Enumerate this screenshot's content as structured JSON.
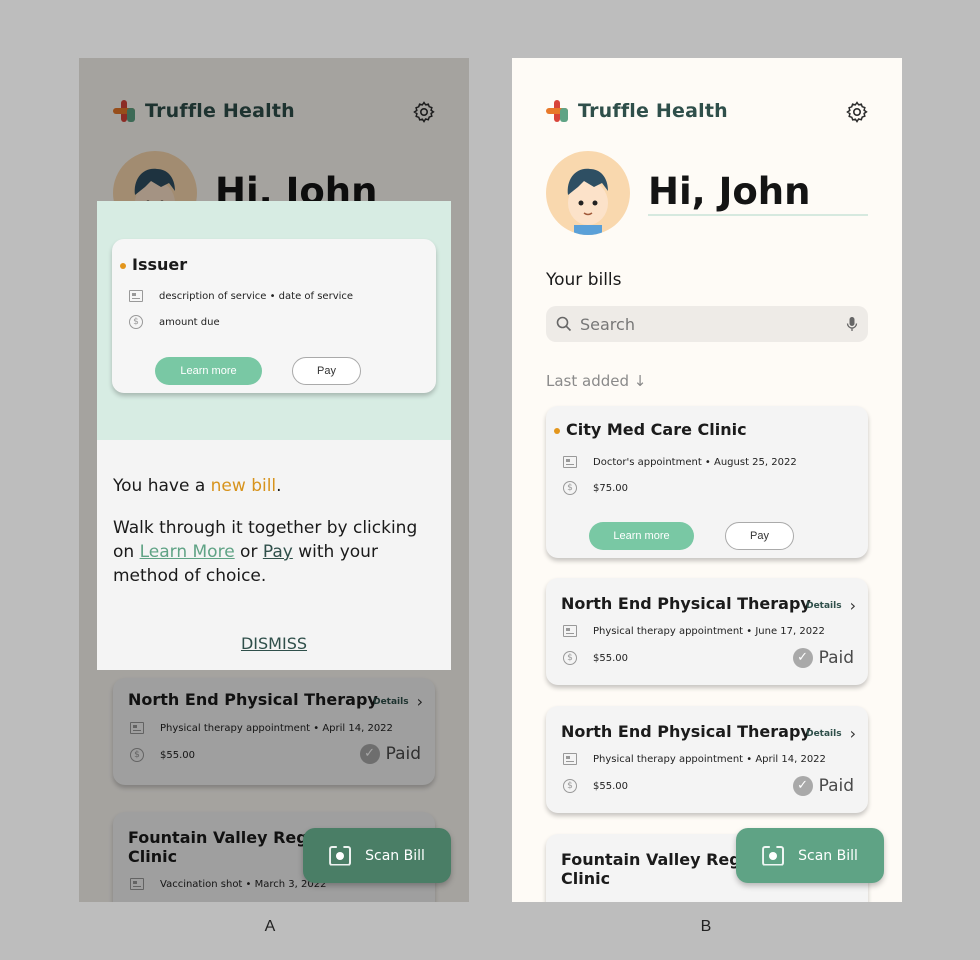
{
  "labels": {
    "a": "A",
    "b": "B"
  },
  "brand": {
    "name": "Truffle Health",
    "colors": {
      "orange": "#e8792a",
      "red": "#d8443a",
      "green": "#5fa385",
      "text": "#2f4f4a"
    }
  },
  "greeting": "Hi, John",
  "bills": {
    "title": "Your bills",
    "search_placeholder": "Search",
    "sort_label": "Last added ↓"
  },
  "screen_a": {
    "greeting": "Hi, John",
    "onboarding": {
      "example_card": {
        "title": "Issuer",
        "description": "description of service • date of service",
        "amount": "amount due",
        "learn_more": "Learn more",
        "pay": "Pay"
      },
      "message_lead": "You have a ",
      "message_highlight": "new bill",
      "message_end": ".",
      "walk_1": "Walk through  it together by clicking",
      "walk_on": "on ",
      "walk_learn": "Learn More",
      "walk_or": " or ",
      "walk_pay": "Pay",
      "walk_end": " with your",
      "walk_3": "method of choice.",
      "dismiss": "DISMISS"
    },
    "cards": [
      {
        "title": "North End Physical Therapy",
        "description": "Physical therapy appointment • April 14, 2022",
        "amount": "$55.00",
        "details": "Details",
        "status": "Paid"
      },
      {
        "title_1": "Fountain Valley Region",
        "title_2": "Clinic",
        "description": "Vaccination shot • March 3, 2022"
      }
    ],
    "scan": "Scan Bill"
  },
  "screen_b": {
    "cards": [
      {
        "title": "City Med Care Clinic",
        "description": "Doctor's appointment • August 25, 2022",
        "amount": "$75.00",
        "learn_more": "Learn more",
        "pay": "Pay"
      },
      {
        "title": "North End Physical Therapy",
        "description": "Physical therapy appointment • June 17, 2022",
        "amount": "$55.00",
        "details": "Details",
        "status": "Paid"
      },
      {
        "title": "North End Physical Therapy",
        "description": "Physical therapy appointment • April 14, 2022",
        "amount": "$55.00",
        "details": "Details",
        "status": "Paid"
      },
      {
        "title_1": "Fountain Valley Region",
        "title_2": "Clinic"
      }
    ],
    "scan": "Scan Bill"
  }
}
